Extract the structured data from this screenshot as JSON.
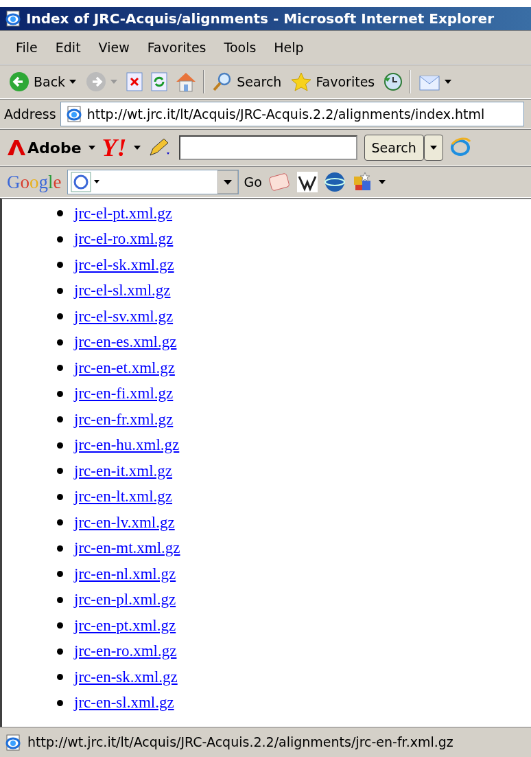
{
  "window": {
    "title": "Index of JRC-Acquis/alignments - Microsoft Internet Explorer"
  },
  "menu": [
    {
      "label": "File"
    },
    {
      "label": "Edit"
    },
    {
      "label": "View"
    },
    {
      "label": "Favorites"
    },
    {
      "label": "Tools"
    },
    {
      "label": "Help"
    }
  ],
  "toolbar": [
    {
      "kind": "back",
      "label": "Back",
      "disabled": false
    },
    {
      "kind": "forward",
      "disabled": true
    },
    {
      "kind": "stop"
    },
    {
      "kind": "refresh"
    },
    {
      "kind": "home"
    },
    {
      "kind": "separator"
    },
    {
      "kind": "search",
      "label": "Search"
    },
    {
      "kind": "favorites",
      "label": "Favorites"
    },
    {
      "kind": "history"
    },
    {
      "kind": "separator"
    },
    {
      "kind": "mail"
    }
  ],
  "address": {
    "label": "Address",
    "url": "http://wt.jrc.it/lt/Acquis/JRC-Acquis.2.2/alignments/index.html"
  },
  "links_bar": {
    "adobe": "Adobe",
    "yahoo": "Y!",
    "search_button": "Search"
  },
  "google_bar": {
    "logo": "Google",
    "go": "Go"
  },
  "links": [
    "jrc-el-pt.xml.gz",
    "jrc-el-ro.xml.gz",
    "jrc-el-sk.xml.gz",
    "jrc-el-sl.xml.gz",
    "jrc-el-sv.xml.gz",
    "jrc-en-es.xml.gz",
    "jrc-en-et.xml.gz",
    "jrc-en-fi.xml.gz",
    "jrc-en-fr.xml.gz",
    "jrc-en-hu.xml.gz",
    "jrc-en-it.xml.gz",
    "jrc-en-lt.xml.gz",
    "jrc-en-lv.xml.gz",
    "jrc-en-mt.xml.gz",
    "jrc-en-nl.xml.gz",
    "jrc-en-pl.xml.gz",
    "jrc-en-pt.xml.gz",
    "jrc-en-ro.xml.gz",
    "jrc-en-sk.xml.gz",
    "jrc-en-sl.xml.gz"
  ],
  "status_bar": {
    "text": "http://wt.jrc.it/lt/Acquis/JRC-Acquis.2.2/alignments/jrc-en-fr.xml.gz"
  }
}
